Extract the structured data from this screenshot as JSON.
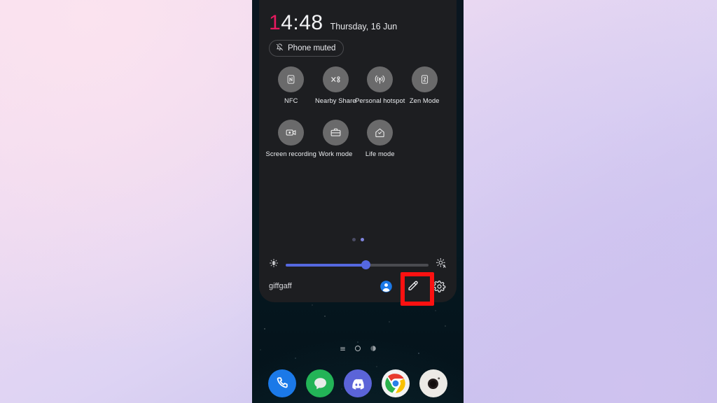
{
  "wallpaper": {
    "name": "starfield-wallpaper",
    "bg_color": "#06141c"
  },
  "page_background": {
    "gradient_from": "#f6dfee",
    "gradient_to": "#c0bdea"
  },
  "quick_settings": {
    "panel_color": "#1d1e21",
    "clock": {
      "hour_first_digit": "1",
      "rest": "4:48",
      "full": "14:48",
      "accent_color": "#e8195f"
    },
    "date": "Thursday, 16 Jun",
    "status_chip": {
      "label": "Phone muted",
      "icon": "bell-muted-icon"
    },
    "tiles_row1": [
      {
        "label": "NFC",
        "icon": "nfc-icon",
        "state": "off"
      },
      {
        "label": "Nearby Share",
        "icon": "nearby-share-icon",
        "state": "off"
      },
      {
        "label": "Personal hotspot",
        "icon": "hotspot-icon",
        "state": "off"
      },
      {
        "label": "Zen Mode",
        "icon": "zen-mode-icon",
        "state": "off"
      }
    ],
    "tiles_row2": [
      {
        "label": "Screen recording",
        "icon": "screen-record-icon",
        "state": "off"
      },
      {
        "label": "Work mode",
        "icon": "briefcase-icon",
        "state": "off"
      },
      {
        "label": "Life mode",
        "icon": "home-shield-icon",
        "state": "off"
      }
    ],
    "pages": {
      "count": 2,
      "active_index": 1
    },
    "brightness": {
      "value_percent": 56,
      "low_icon": "brightness-low-icon",
      "auto_icon": "brightness-auto-icon",
      "fill_color": "#5568e0",
      "track_color": "#4a4b50"
    },
    "footer": {
      "carrier": "giffgaff",
      "actions": [
        {
          "name": "user-account-button",
          "icon": "user-circle-icon",
          "color": "#1b79e8"
        },
        {
          "name": "edit-tiles-button",
          "icon": "pencil-icon",
          "highlighted": true
        },
        {
          "name": "settings-button",
          "icon": "gear-icon"
        }
      ]
    }
  },
  "highlight": {
    "color": "#fb1111",
    "target": "edit-tiles-button",
    "border_width_px": 6
  },
  "navbar": [
    {
      "name": "recents-button",
      "icon": "recents-icon"
    },
    {
      "name": "home-button",
      "icon": "home-circle-icon"
    },
    {
      "name": "back-button",
      "icon": "back-icon"
    }
  ],
  "dock": [
    {
      "label": "Phone",
      "icon": "phone-icon",
      "color": "#1b79e8"
    },
    {
      "label": "Messages",
      "icon": "message-icon",
      "color": "#23b457"
    },
    {
      "label": "Discord",
      "icon": "discord-icon",
      "color": "#5b64d8"
    },
    {
      "label": "Chrome",
      "icon": "chrome-icon",
      "color": "#f2f2f2"
    },
    {
      "label": "Camera",
      "icon": "camera-icon",
      "color": "#eceae6"
    }
  ]
}
